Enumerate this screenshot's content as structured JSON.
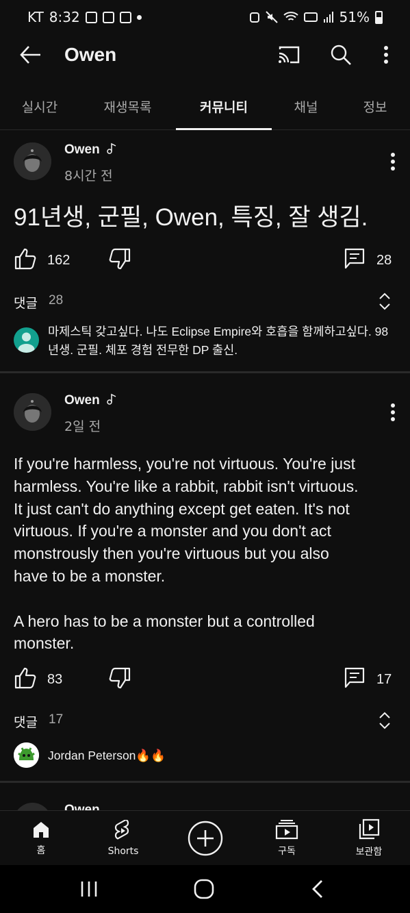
{
  "status_bar": {
    "carrier": "KT",
    "time": "8:32",
    "battery": "51%"
  },
  "app_bar": {
    "title": "Owen"
  },
  "tabs": [
    {
      "label": "실시간"
    },
    {
      "label": "재생목록"
    },
    {
      "label": "커뮤니티",
      "active": true
    },
    {
      "label": "채널"
    },
    {
      "label": "정보"
    }
  ],
  "posts": [
    {
      "author": "Owen",
      "time": "8시간 전",
      "text": "91년생, 군필, Owen, 특징, 잘 생김.",
      "likes": "162",
      "comment_count": "28",
      "comments_label": "댓글",
      "comments_total": "28",
      "top_comment": "마제스틱 갖고싶다. 나도 Eclipse Empire와 호흡을 함께하고싶다. 98년생. 군필. 체포 경험 전무한 DP 출신."
    },
    {
      "author": "Owen",
      "time": "2일 전",
      "text_lines": [
        "If you're harmless, you're not virtuous. You're just",
        "harmless. You're like a rabbit, rabbit isn't virtuous.",
        "It just can't do anything except get eaten. It's not",
        "virtuous. If you're a monster and you don't act",
        "monstrously then you're virtuous but you also",
        "have to be a monster.",
        "",
        "A hero has to be a monster but a controlled",
        "monster."
      ],
      "likes": "83",
      "comment_count": "17",
      "comments_label": "댓글",
      "comments_total": "17",
      "top_comment": "Jordan Peterson🔥🔥"
    },
    {
      "author": "Owen"
    }
  ],
  "bottom_nav": [
    {
      "label": "홈",
      "icon": "home-icon"
    },
    {
      "label": "Shorts",
      "icon": "shorts-icon"
    },
    {
      "label": "",
      "icon": "create-icon"
    },
    {
      "label": "구독",
      "icon": "subscriptions-icon"
    },
    {
      "label": "보관함",
      "icon": "library-icon"
    }
  ],
  "colors": {
    "background": "#0f0f0f",
    "text": "#f1f1f1",
    "secondary_text": "#aaaaaa",
    "divider": "#2a2a2a"
  }
}
